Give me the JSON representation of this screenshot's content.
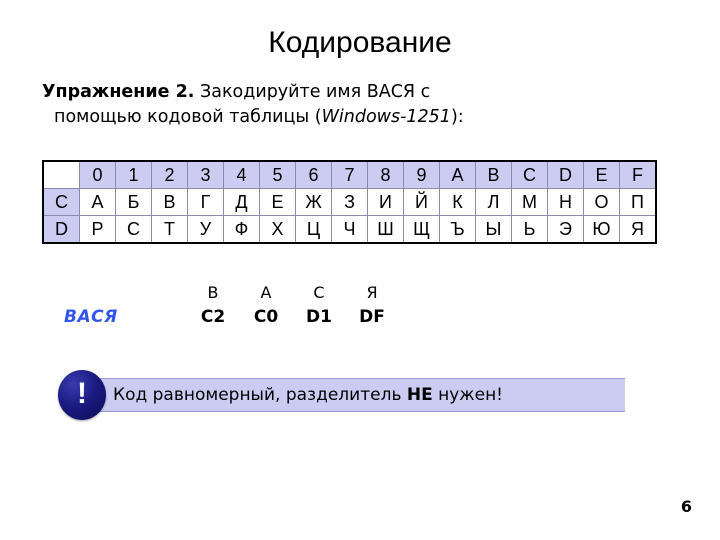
{
  "slide": {
    "title": "Кодирование",
    "page_number": "6"
  },
  "exercise": {
    "lead": "Упражнение 2.",
    "text_part1": " Закодируйте имя ВАСЯ с",
    "text_part2": "помощью кодовой таблицы (",
    "charset": "Windows-1251",
    "text_part3": "):"
  },
  "code_table": {
    "corner": "",
    "column_headers": [
      "0",
      "1",
      "2",
      "3",
      "4",
      "5",
      "6",
      "7",
      "8",
      "9",
      "A",
      "B",
      "C",
      "D",
      "E",
      "F"
    ],
    "rows": [
      {
        "header": "C",
        "cells": [
          "А",
          "Б",
          "В",
          "Г",
          "Д",
          "Е",
          "Ж",
          "З",
          "И",
          "Й",
          "К",
          "Л",
          "М",
          "Н",
          "О",
          "П"
        ]
      },
      {
        "header": "D",
        "cells": [
          "Р",
          "С",
          "Т",
          "У",
          "Ф",
          "Х",
          "Ц",
          "Ч",
          "Ш",
          "Щ",
          "Ъ",
          "Ы",
          "Ь",
          "Э",
          "Ю",
          "Я"
        ]
      }
    ],
    "header_color": "#ccccf2",
    "border_color": "#000000"
  },
  "answer": {
    "word": "ВАСЯ",
    "word_color": "#3355ee",
    "columns": [
      {
        "letter": "В",
        "code": "C2"
      },
      {
        "letter": "А",
        "code": "C0"
      },
      {
        "letter": "С",
        "code": "D1"
      },
      {
        "letter": "Я",
        "code": "DF"
      }
    ]
  },
  "callout": {
    "icon": "exclamation-icon",
    "icon_glyph": "!",
    "text_part1": "Код равномерный, разделитель ",
    "emphasis": "НЕ",
    "text_part2": " нужен!",
    "background_color": "#ccccf2"
  }
}
